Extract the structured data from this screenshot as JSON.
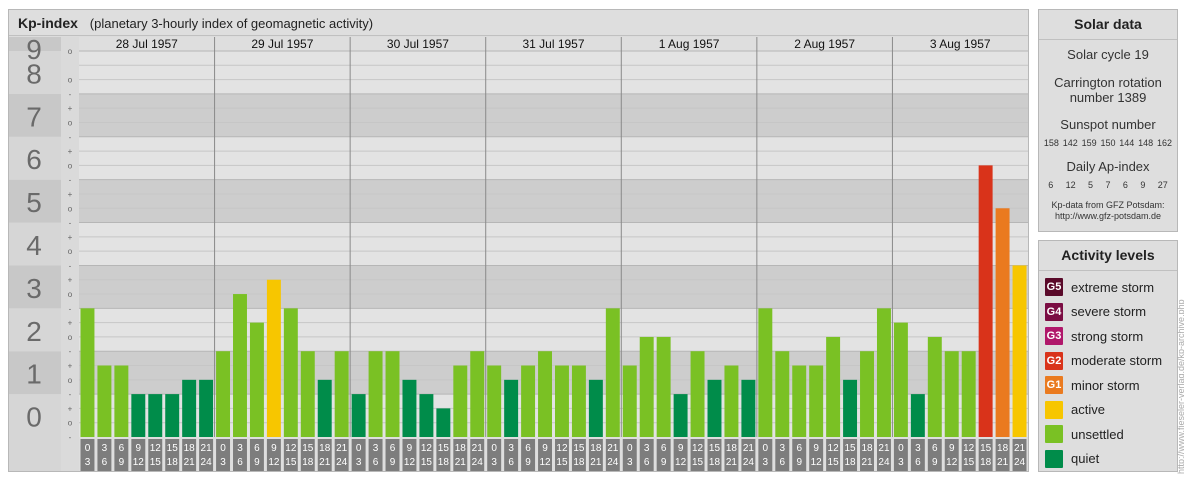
{
  "header": {
    "title": "Kp-index",
    "subtitle": "(planetary 3-hourly index of geomagnetic activity)"
  },
  "solar": {
    "title": "Solar data",
    "cycle": "Solar cycle 19",
    "carrington_line1": "Carrington rotation",
    "carrington_line2": "number 1389",
    "sunspot_title": "Sunspot number",
    "sunspot_values": [
      "158",
      "142",
      "159",
      "150",
      "144",
      "148",
      "162"
    ],
    "ap_title": "Daily Ap-index",
    "ap_values": [
      "6",
      "12",
      "5",
      "7",
      "6",
      "9",
      "27"
    ],
    "source_line1": "Kp-data from GFZ Potsdam:",
    "source_line2": "http://www.gfz-potsdam.de"
  },
  "activity": {
    "title": "Activity levels",
    "items": [
      {
        "badge": "G5",
        "label": "extreme storm",
        "color": "#5a0a2a"
      },
      {
        "badge": "G4",
        "label": "severe storm",
        "color": "#7b0d43"
      },
      {
        "badge": "G3",
        "label": "strong storm",
        "color": "#b0176a"
      },
      {
        "badge": "G2",
        "label": "moderate storm",
        "color": "#d9331a"
      },
      {
        "badge": "G1",
        "label": "minor storm",
        "color": "#ea7a1f"
      },
      {
        "badge": "",
        "label": "active",
        "color": "#f7c600"
      },
      {
        "badge": "",
        "label": "unsettled",
        "color": "#7ac124"
      },
      {
        "badge": "",
        "label": "quiet",
        "color": "#008c4a"
      }
    ]
  },
  "watermark": "http://www.fieseler-verlag.de/kp-archive.php",
  "chart_data": {
    "type": "bar",
    "ylim": [
      0,
      9
    ],
    "y_ticks": [
      "0",
      "1",
      "2",
      "3",
      "4",
      "5",
      "6",
      "7",
      "8",
      "9"
    ],
    "y_subticks": [
      "-",
      "o",
      "+"
    ],
    "days": [
      "28 Jul 1957",
      "29 Jul 1957",
      "30 Jul 1957",
      "31 Jul 1957",
      "1 Aug 1957",
      "2 Aug 1957",
      "3 Aug 1957"
    ],
    "interval_start": [
      "0",
      "3",
      "6",
      "9",
      "12",
      "15",
      "18",
      "21"
    ],
    "interval_end": [
      "3",
      "6",
      "9",
      "12",
      "15",
      "18",
      "21",
      "24"
    ],
    "values": [
      [
        3.0,
        1.667,
        1.667,
        1.0,
        1.0,
        1.0,
        1.333,
        1.333
      ],
      [
        2.0,
        3.333,
        2.667,
        3.667,
        3.0,
        2.0,
        1.333,
        2.0
      ],
      [
        1.0,
        2.0,
        2.0,
        1.333,
        1.0,
        0.667,
        1.667,
        2.0
      ],
      [
        1.667,
        1.333,
        1.667,
        2.0,
        1.667,
        1.667,
        1.333,
        3.0
      ],
      [
        1.667,
        2.333,
        2.333,
        1.0,
        2.0,
        1.333,
        1.667,
        1.333
      ],
      [
        3.0,
        2.0,
        1.667,
        1.667,
        2.333,
        1.333,
        2.0,
        3.0
      ],
      [
        2.667,
        1.0,
        2.333,
        2.0,
        2.0,
        6.333,
        5.333,
        4.0
      ]
    ],
    "level_colors": {
      "quiet": "#008c4a",
      "unsettled": "#7ac124",
      "active": "#f7c600",
      "G1": "#ea7a1f",
      "G2": "#d9331a",
      "G3": "#b0176a",
      "G4": "#7b0d43",
      "G5": "#5a0a2a"
    }
  }
}
